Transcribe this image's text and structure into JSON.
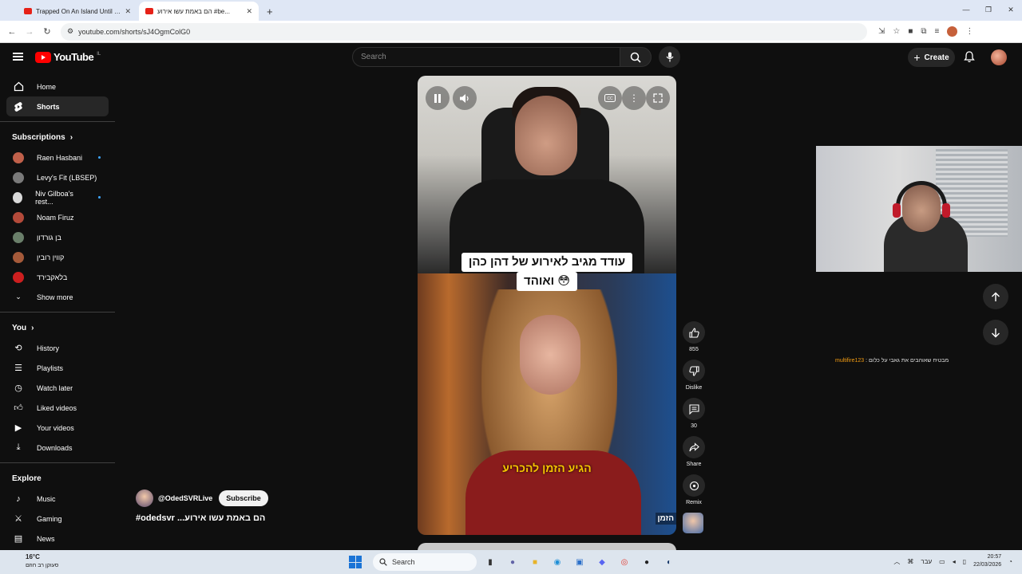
{
  "browser": {
    "tabs": [
      {
        "title": "Trapped On An Island Until I Bu",
        "active": false
      },
      {
        "title": "‏הם באמת עשו אירוע‎ #be...",
        "active": true
      }
    ],
    "url": "youtube.com/shorts/sJ4OgmColG0"
  },
  "youtube": {
    "logo_text": "YouTube",
    "region": "IL",
    "search_placeholder": "Search",
    "create_label": "Create"
  },
  "sidebar": {
    "main": [
      {
        "label": "Home",
        "icon": "home-icon"
      },
      {
        "label": "Shorts",
        "icon": "shorts-icon",
        "active": true
      }
    ],
    "subscriptions_title": "Subscriptions",
    "subscriptions": [
      {
        "label": "Raen Hasbani",
        "color": "#c0604a",
        "live_dot": true
      },
      {
        "label": "Levy's Fit (LBSEP)",
        "color": "#7a7a7a",
        "live_dot": false
      },
      {
        "label": "Niv Gilboa's rest...",
        "color": "#d9d9d9",
        "live_dot": true
      },
      {
        "label": "Noam Firuz",
        "color": "#b34a3a",
        "live_dot": false
      },
      {
        "label": "בן גורדון",
        "color": "#6a7f6a",
        "live_dot": false
      },
      {
        "label": "קווין רובין",
        "color": "#a55a3a",
        "live_dot": false
      },
      {
        "label": "בלאקבירד",
        "color": "#cc1f1f",
        "live_dot": false
      }
    ],
    "show_more": "Show more",
    "you_title": "You",
    "you": [
      {
        "label": "History",
        "icon": "history-icon"
      },
      {
        "label": "Playlists",
        "icon": "playlists-icon"
      },
      {
        "label": "Watch later",
        "icon": "watch-later-icon"
      },
      {
        "label": "Liked videos",
        "icon": "like-icon"
      },
      {
        "label": "Your videos",
        "icon": "your-videos-icon"
      },
      {
        "label": "Downloads",
        "icon": "download-icon"
      }
    ],
    "explore_title": "Explore",
    "explore": [
      {
        "label": "Music",
        "icon": "music-icon"
      },
      {
        "label": "Gaming",
        "icon": "gaming-icon"
      },
      {
        "label": "News",
        "icon": "news-icon"
      }
    ]
  },
  "video": {
    "caption_line1": "עודד מגיב לאירוע של דהן כהן",
    "caption_line2": "ואוהד 😳",
    "subtitle": "הגיע הזמן להכריע",
    "watermark": "הזמן"
  },
  "actions": {
    "likes": "855",
    "dislike_label": "Dislike",
    "comments": "30",
    "share_label": "Share",
    "remix_label": "Remix"
  },
  "channel": {
    "handle": "@OdedSVRLive",
    "subscribe_label": "Subscribe",
    "title": "#odedsvr ...הם באמת עשו אירוע"
  },
  "overlay": {
    "chat_user": "multifire123",
    "chat_text": ": מבטיח שאוהבים את גאבי על כלום"
  },
  "taskbar": {
    "temperature": "16°C",
    "weather_text": "סעוקן רב חוזם",
    "search_label": "Search",
    "lang": "עבר",
    "time": "20:57",
    "date": "22/03/2026"
  }
}
